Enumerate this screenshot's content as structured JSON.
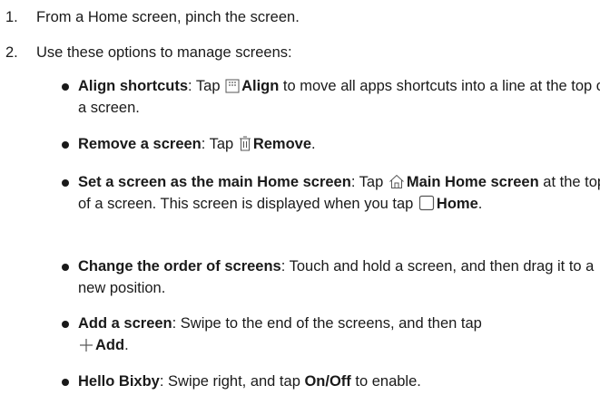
{
  "steps": [
    {
      "num": "1.",
      "text": "From a Home screen, pinch the screen."
    },
    {
      "num": "2.",
      "text": "Use these options to manage screens:"
    }
  ],
  "bullets": {
    "align": {
      "title": "Align shortcuts",
      "pre": ": Tap ",
      "icon": "grid-icon",
      "btn": "Align",
      "post": " to move all apps shortcuts into a line at the top of a screen."
    },
    "remove": {
      "title": "Remove a screen",
      "pre": ": Tap ",
      "icon": "trash-icon",
      "btn": "Remove",
      "post": "."
    },
    "main_home": {
      "title": "Set a screen as the main Home screen",
      "pre": ": Tap ",
      "icon": "home-icon",
      "btn": "Main Home screen",
      "mid": " at the top of a screen. This screen is displayed when you tap ",
      "icon2": "home-key-icon",
      "btn2": "Home",
      "post": "."
    },
    "order": {
      "title": "Change the order of screens",
      "post": ": Touch and hold a screen, and then drag it to a new position."
    },
    "add": {
      "title": "Add a screen",
      "pre": ": Swipe to the end of the screens, and then tap ",
      "icon": "plus-icon",
      "btn": "Add",
      "post": "."
    },
    "bixby": {
      "title": "Hello Bixby",
      "pre": ": Swipe right, and tap ",
      "btn": "On/Off",
      "post": " to enable."
    }
  }
}
